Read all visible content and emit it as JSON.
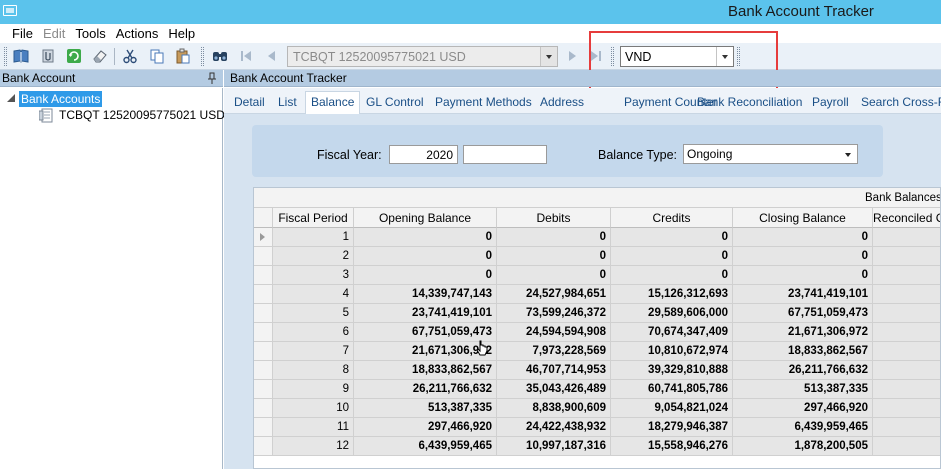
{
  "window": {
    "title": "Bank Account Tracker"
  },
  "menu": [
    "File",
    "Edit",
    "Tools",
    "Actions",
    "Help"
  ],
  "menu_disabled": [
    "Edit"
  ],
  "toolbar": {
    "icons": [
      "book-icon",
      "attach-icon",
      "refresh-icon",
      "eraser-icon",
      "cut-icon",
      "copy-icon",
      "paste-icon",
      "find-icon",
      "first-record-icon",
      "prev-record-icon",
      "next-record-icon",
      "last-record-icon"
    ],
    "account_value": "TCBQT 12520095775021 USD",
    "currency_value": "VND"
  },
  "left_panel": {
    "title": "Bank Account",
    "tree_root": "Bank Accounts",
    "tree_child": "TCBQT 12520095775021 USD"
  },
  "right_panel": {
    "title": "Bank Account Tracker",
    "tabs": [
      "Detail",
      "List",
      "Balance",
      "GL Control",
      "Payment Methods",
      "Address",
      "Payment Counter",
      "Bank Reconciliation",
      "Payroll",
      "Search Cross-R"
    ],
    "active_tab": "Balance"
  },
  "params": {
    "fiscal_year_label": "Fiscal Year:",
    "fiscal_year_value": "2020",
    "fiscal_year_extra": "",
    "balance_type_label": "Balance Type:",
    "balance_type_value": "Ongoing"
  },
  "grid": {
    "band_title": "Bank Balances",
    "columns": [
      "Fiscal Period",
      "Opening Balance",
      "Debits",
      "Credits",
      "Closing Balance",
      "Reconciled C"
    ],
    "rows": [
      [
        "1",
        "0",
        "0",
        "0",
        "0"
      ],
      [
        "2",
        "0",
        "0",
        "0",
        "0"
      ],
      [
        "3",
        "0",
        "0",
        "0",
        "0"
      ],
      [
        "4",
        "14,339,747,143",
        "24,527,984,651",
        "15,126,312,693",
        "23,741,419,101"
      ],
      [
        "5",
        "23,741,419,101",
        "73,599,246,372",
        "29,589,606,000",
        "67,751,059,473"
      ],
      [
        "6",
        "67,751,059,473",
        "24,594,594,908",
        "70,674,347,409",
        "21,671,306,972"
      ],
      [
        "7",
        "21,671,306,972",
        "7,973,228,569",
        "10,810,672,974",
        "18,833,862,567"
      ],
      [
        "8",
        "18,833,862,567",
        "46,707,714,953",
        "39,329,810,888",
        "26,211,766,632"
      ],
      [
        "9",
        "26,211,766,632",
        "35,043,426,489",
        "60,741,805,786",
        "513,387,335"
      ],
      [
        "10",
        "513,387,335",
        "8,838,900,609",
        "9,054,821,024",
        "297,466,920"
      ],
      [
        "11",
        "297,466,920",
        "24,422,438,932",
        "18,279,946,387",
        "6,439,959,465"
      ],
      [
        "12",
        "6,439,959,465",
        "10,997,187,316",
        "15,558,946,276",
        "1,878,200,505"
      ]
    ]
  },
  "colors": {
    "titlebar": "#5bc3ec",
    "highlight": "#e63c3c",
    "selection": "#2f9ae8"
  }
}
